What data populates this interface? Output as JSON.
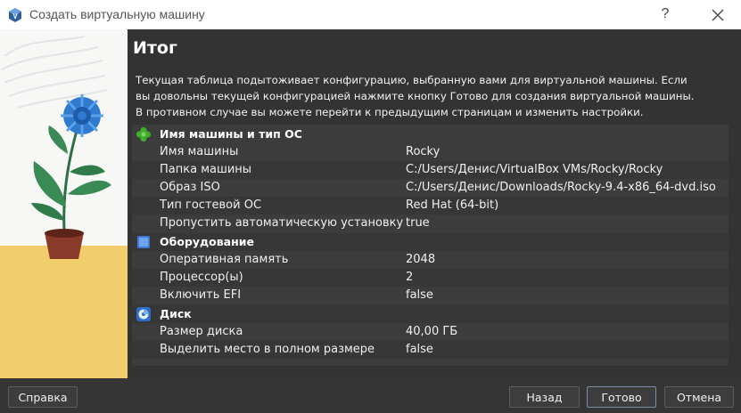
{
  "window": {
    "title": "Создать виртуальную машину",
    "help_glyph": "?",
    "close_glyph": "close-icon"
  },
  "page": {
    "heading": "Итог",
    "description_lines": [
      "Текущая таблица подытоживает конфигурацию, выбранную вами для виртуальной машины. Если",
      "вы довольны текущей конфигурацией нажмите кнопку Готово для создания виртуальной машины.",
      "В противном случае вы можете перейти к предыдущим страницам и изменить настройки."
    ]
  },
  "summary": {
    "general": {
      "title": "Имя машины и тип ОС",
      "icon": "green-clover-icon",
      "rows": [
        {
          "key": "Имя машины",
          "value": "Rocky"
        },
        {
          "key": "Папка машины",
          "value": "C:/Users/Денис/VirtualBox VMs/Rocky/Rocky"
        },
        {
          "key": "Образ ISO",
          "value": "C:/Users/Денис/Downloads/Rocky-9.4-x86_64-dvd.iso"
        },
        {
          "key": "Тип гостевой ОС",
          "value": "Red Hat (64-bit)"
        },
        {
          "key": "Пропустить автоматическую установку",
          "value": "true"
        }
      ]
    },
    "hardware": {
      "title": "Оборудование",
      "icon": "chip-icon",
      "rows": [
        {
          "key": "Оперативная память",
          "value": "2048"
        },
        {
          "key": "Процессор(ы)",
          "value": "2"
        },
        {
          "key": "Включить EFI",
          "value": "false"
        }
      ]
    },
    "disk": {
      "title": "Диск",
      "icon": "disk-icon",
      "rows": [
        {
          "key": "Размер диска",
          "value": "40,00 ГБ"
        },
        {
          "key": "Выделить место в полном размере",
          "value": "false"
        }
      ]
    }
  },
  "buttons": {
    "help": "Справка",
    "back": "Назад",
    "finish": "Готово",
    "cancel": "Отмена"
  },
  "colors": {
    "background": "#353535",
    "table_bg": "#3c3c3c",
    "accent_green": "#3fae2a",
    "accent_blue": "#3e7bd6"
  }
}
